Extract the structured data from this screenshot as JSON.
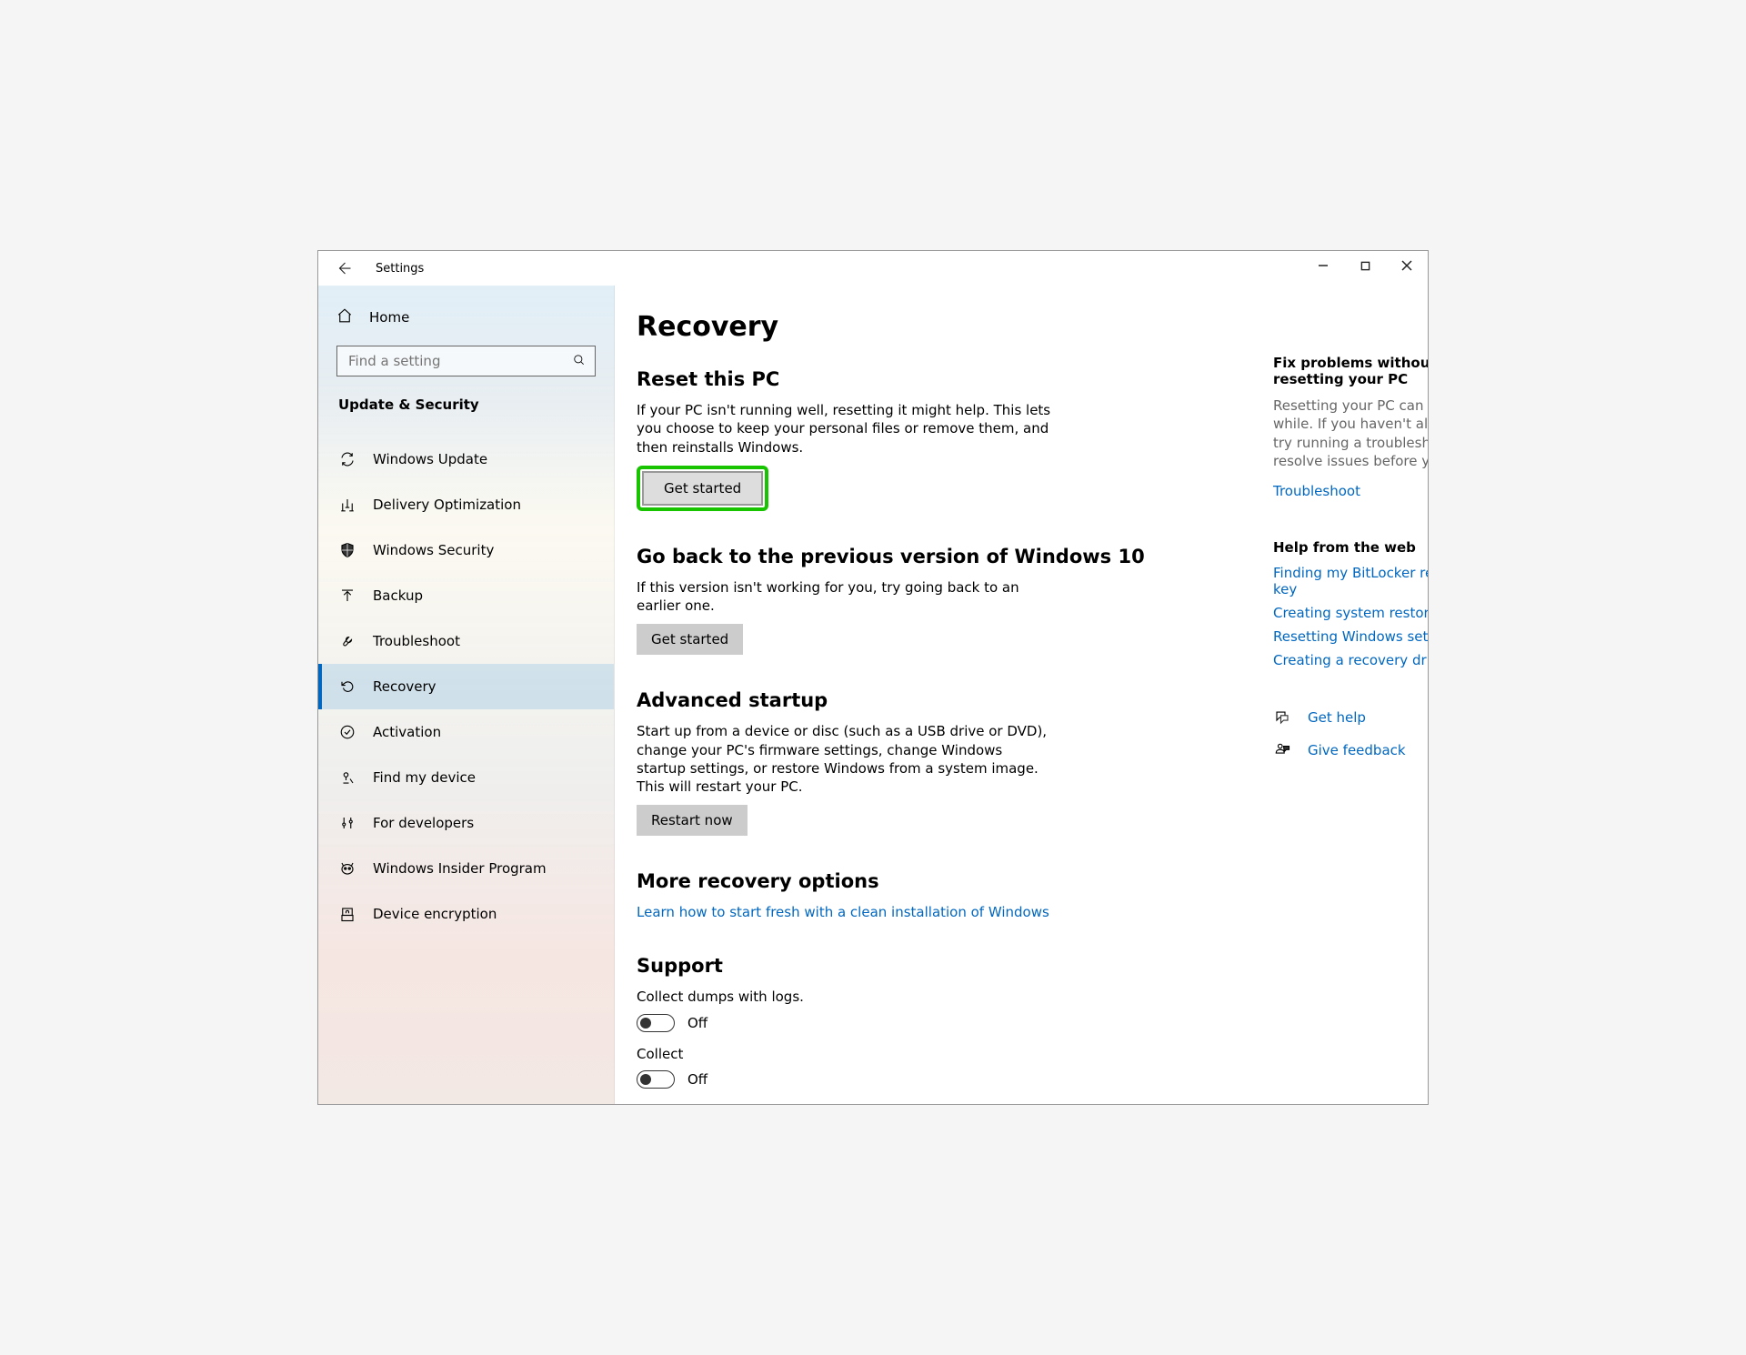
{
  "window": {
    "title": "Settings"
  },
  "sidebar": {
    "home_label": "Home",
    "search_placeholder": "Find a setting",
    "category_title": "Update & Security",
    "items": [
      {
        "label": "Windows Update",
        "icon": "sync-icon"
      },
      {
        "label": "Delivery Optimization",
        "icon": "delivery-icon"
      },
      {
        "label": "Windows Security",
        "icon": "shield-icon"
      },
      {
        "label": "Backup",
        "icon": "upload-icon"
      },
      {
        "label": "Troubleshoot",
        "icon": "wrench-icon"
      },
      {
        "label": "Recovery",
        "icon": "recovery-icon"
      },
      {
        "label": "Activation",
        "icon": "check-circle-icon"
      },
      {
        "label": "Find my device",
        "icon": "find-device-icon"
      },
      {
        "label": "For developers",
        "icon": "dev-tools-icon"
      },
      {
        "label": "Windows Insider Program",
        "icon": "insider-icon"
      },
      {
        "label": "Device encryption",
        "icon": "lock-icon"
      }
    ],
    "active_index": 5
  },
  "main": {
    "page_title": "Recovery",
    "reset": {
      "heading": "Reset this PC",
      "description": "If your PC isn't running well, resetting it might help. This lets you choose to keep your personal files or remove them, and then reinstalls Windows.",
      "button": "Get started"
    },
    "goback": {
      "heading": "Go back to the previous version of Windows 10",
      "description": "If this version isn't working for you, try going back to an earlier one.",
      "button": "Get started"
    },
    "advanced": {
      "heading": "Advanced startup",
      "description": "Start up from a device or disc (such as a USB drive or DVD), change your PC's firmware settings, change Windows startup settings, or restore Windows from a system image. This will restart your PC.",
      "button": "Restart now"
    },
    "more": {
      "heading": "More recovery options",
      "link": "Learn how to start fresh with a clean installation of Windows"
    },
    "support": {
      "heading": "Support",
      "option1_label": "Collect dumps with logs.",
      "option1_state": "Off",
      "option2_label": "Collect",
      "option2_state": "Off"
    }
  },
  "aside": {
    "fix": {
      "title": "Fix problems without resetting your PC",
      "description": "Resetting your PC can take a while. If you haven't already, try running a troubleshooter to resolve issues before you reset.",
      "link": "Troubleshoot"
    },
    "help": {
      "title": "Help from the web",
      "links": [
        "Finding my BitLocker recovery key",
        "Creating system restore point",
        "Resetting Windows settings",
        "Creating a recovery drive"
      ]
    },
    "actions": {
      "get_help": "Get help",
      "give_feedback": "Give feedback"
    }
  }
}
